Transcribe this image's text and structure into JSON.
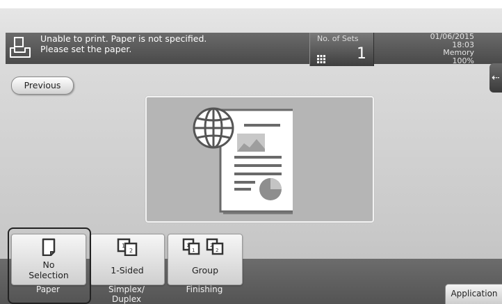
{
  "header": {
    "message_line1": "Unable to print. Paper is not specified.",
    "message_line2": "Please set the paper.",
    "sets_label": "No. of Sets",
    "sets_value": "1",
    "date": "01/06/2015",
    "time": "18:03",
    "memory_label": "Memory",
    "memory_value": "100%"
  },
  "nav": {
    "previous_label": "Previous"
  },
  "functions": [
    {
      "value_line1": "No",
      "value_line2": "Selection",
      "label": "Paper"
    },
    {
      "value": "1-Sided",
      "label_line1": "Simplex/",
      "label_line2": "Duplex"
    },
    {
      "value": "Group",
      "label": "Finishing"
    }
  ],
  "footer": {
    "application_label": "Application"
  },
  "icons": {
    "status": "printer-icon",
    "keypad": "keypad-icon",
    "side_tab": "double-arrow-left-icon",
    "preview": "document-preview-icon",
    "paper": "paper-sheet-icon",
    "simplex": "one-sided-icon",
    "finishing": "group-icon"
  },
  "colors": {
    "header_bg": "#555555",
    "preview_bg": "#b5b5b5",
    "bottom_bar": "#5f5f5f"
  }
}
